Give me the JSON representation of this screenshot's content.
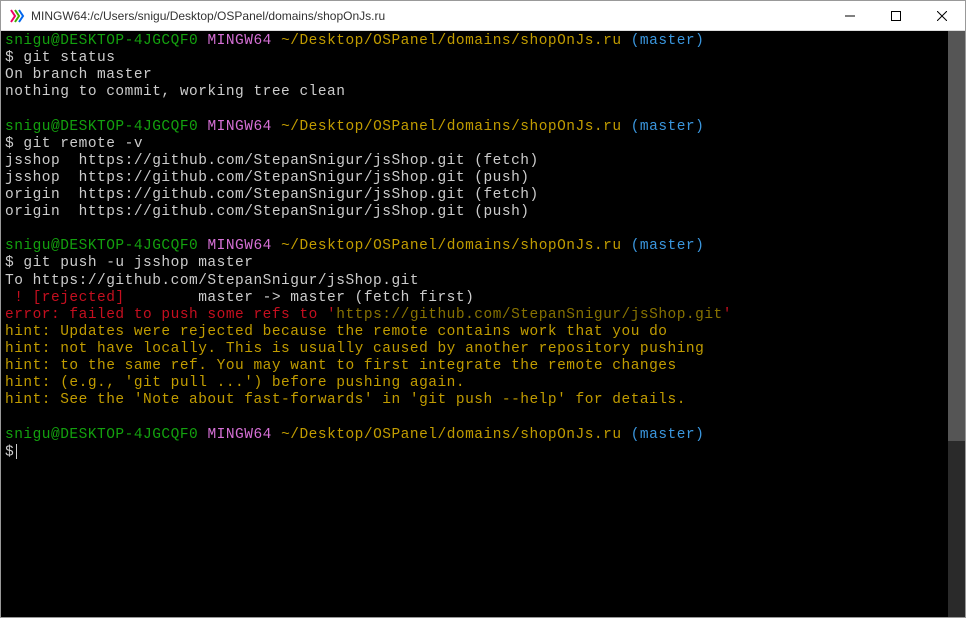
{
  "window": {
    "title": "MINGW64:/c/Users/snigu/Desktop/OSPanel/domains/shopOnJs.ru"
  },
  "prompt": {
    "user_host": "snigu@DESKTOP-4JGCQF0",
    "env": "MINGW64",
    "path": "~/Desktop/OSPanel/domains/shopOnJs.ru",
    "branch": "(master)"
  },
  "blocks": [
    {
      "command": "git status",
      "output": [
        {
          "text": "On branch master",
          "class": "c-white"
        },
        {
          "text": "nothing to commit, working tree clean",
          "class": "c-white"
        }
      ]
    },
    {
      "command": "git remote -v",
      "output": [
        {
          "text": "jsshop  https://github.com/StepanSnigur/jsShop.git (fetch)",
          "class": "c-white"
        },
        {
          "text": "jsshop  https://github.com/StepanSnigur/jsShop.git (push)",
          "class": "c-white"
        },
        {
          "text": "origin  https://github.com/StepanSnigur/jsShop.git (fetch)",
          "class": "c-white"
        },
        {
          "text": "origin  https://github.com/StepanSnigur/jsShop.git (push)",
          "class": "c-white"
        }
      ]
    },
    {
      "command": "git push -u jsshop master",
      "output": [
        {
          "text": "To https://github.com/StepanSnigur/jsShop.git",
          "class": "c-white"
        },
        {
          "segments": [
            {
              "text": " ! [rejected]       ",
              "class": "c-red"
            },
            {
              "text": " master -> master (fetch first)",
              "class": "c-white"
            }
          ]
        },
        {
          "segments": [
            {
              "text": "error: failed to push some refs to '",
              "class": "c-red"
            },
            {
              "text": "https://github.com/StepanSnigur/jsShop.git",
              "class": "c-dim-yellow"
            },
            {
              "text": "'",
              "class": "c-red"
            }
          ]
        },
        {
          "text": "hint: Updates were rejected because the remote contains work that you do",
          "class": "c-yellow"
        },
        {
          "text": "hint: not have locally. This is usually caused by another repository pushing",
          "class": "c-yellow"
        },
        {
          "text": "hint: to the same ref. You may want to first integrate the remote changes",
          "class": "c-yellow"
        },
        {
          "text": "hint: (e.g., 'git pull ...') before pushing again.",
          "class": "c-yellow"
        },
        {
          "text": "hint: See the 'Note about fast-forwards' in 'git push --help' for details.",
          "class": "c-yellow"
        }
      ]
    }
  ],
  "final_prompt": true
}
